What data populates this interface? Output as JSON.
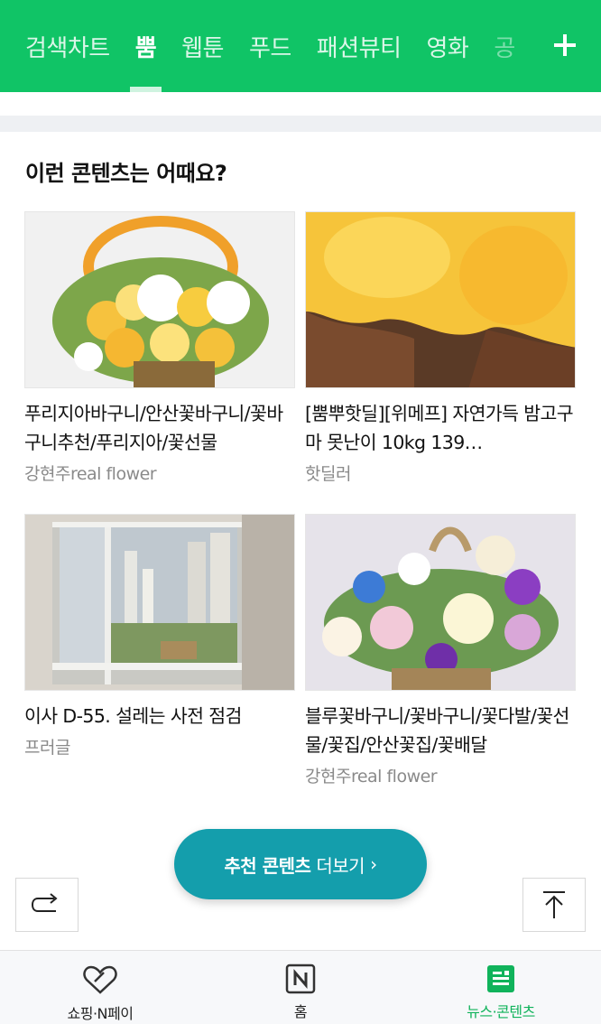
{
  "tabs": [
    "검색차트",
    "뿜",
    "웹툰",
    "푸드",
    "패션뷰티",
    "영화",
    "공"
  ],
  "active_tab_index": 1,
  "section_title": "이런 콘텐츠는 어때요?",
  "cards": [
    {
      "title": "푸리지아바구니/안산꽃바구니/꽃바구니추천/푸리지아/꽃선물",
      "source": "강현주real flower",
      "image": "yellow-flower-basket"
    },
    {
      "title": "[뿜뿌핫딜][위메프] 자연가득 밤고구마 못난이 10kg 139…",
      "source": "핫딜러",
      "image": "roasted-sweet-potato"
    },
    {
      "title": "이사 D-55. 설레는 사전 점검",
      "source": "프러글",
      "image": "apartment-window-view"
    },
    {
      "title": "블루꽃바구니/꽃바구니/꽃다발/꽃선물/꽃집/안산꽃집/꽃배달",
      "source": "강현주real flower",
      "image": "blue-flower-basket"
    }
  ],
  "more_button": {
    "bold": "추천 콘텐츠",
    "rest": "더보기",
    "chevron": "›"
  },
  "bottom_nav": [
    {
      "label": "쇼핑·N페이",
      "icon": "heart-tag-icon"
    },
    {
      "label": "홈",
      "icon": "n-logo-icon"
    },
    {
      "label": "뉴스·콘텐츠",
      "icon": "news-icon"
    }
  ],
  "colors": {
    "brand_green": "#10c466",
    "accent_teal": "#149eac",
    "active_nav_green": "#10b35b"
  }
}
